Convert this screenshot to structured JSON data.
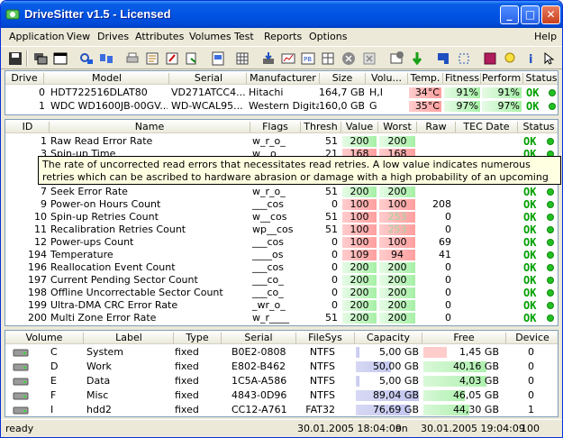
{
  "window": {
    "title": "DriveSitter v1.5 - Licensed"
  },
  "menu": [
    "Application",
    "View",
    "Drives",
    "Attributes",
    "Volumes",
    "Test",
    "Reports",
    "Options"
  ],
  "help": "Help",
  "drives": {
    "headers": [
      "Drive",
      "Model",
      "Serial",
      "Manufacturer",
      "Size",
      "Volu...",
      "Temp.",
      "Fitness",
      "Perform.",
      "Status"
    ],
    "rows": [
      {
        "drive": "0",
        "model": "HDT722516DLAT80",
        "serial": "VD271ATCC4...",
        "manufacturer": "Hitachi",
        "size": "164,7 GB",
        "volumes": "H,I",
        "temp": "34°C",
        "fitness": "91%",
        "perform": "91%",
        "status": "OK"
      },
      {
        "drive": "1",
        "model": "WDC WD1600JB-00GV...",
        "serial": "WD-WCAL95...",
        "manufacturer": "Western Digital",
        "size": "160,0 GB",
        "volumes": "G",
        "temp": "35°C",
        "fitness": "97%",
        "perform": "97%",
        "status": "OK"
      }
    ]
  },
  "attributes": {
    "headers": [
      "ID",
      "Name",
      "Flags",
      "Thresh",
      "Value",
      "Worst",
      "Raw",
      "TEC Date",
      "Status"
    ],
    "rows": [
      {
        "id": "1",
        "name": "Raw Read Error Rate",
        "flags": "w_r_o_",
        "thresh": "51",
        "value": "200",
        "worst": "200",
        "raw": "",
        "tec": "",
        "status": "OK",
        "tone": "green"
      },
      {
        "id": "3",
        "name": "Spin-up Time",
        "flags": "w__o_",
        "thresh": "21",
        "value": "168",
        "worst": "168",
        "raw": "",
        "tec": "",
        "status": "OK",
        "tone": "red"
      },
      {
        "id": "7",
        "name": "Seek Error Rate",
        "flags": "w_r_o_",
        "thresh": "51",
        "value": "200",
        "worst": "200",
        "raw": "",
        "tec": "",
        "status": "OK",
        "tone": "green"
      },
      {
        "id": "9",
        "name": "Power-on Hours Count",
        "flags": "___cos",
        "thresh": "0",
        "value": "100",
        "worst": "100",
        "raw": "208",
        "tec": "",
        "status": "OK",
        "tone": "red"
      },
      {
        "id": "10",
        "name": "Spin-up Retries Count",
        "flags": "w__cos",
        "thresh": "51",
        "value": "100",
        "worst": "253",
        "raw": "0",
        "tec": "",
        "status": "OK",
        "tone": "red"
      },
      {
        "id": "11",
        "name": "Recalibration Retries Count",
        "flags": "wp__cos",
        "thresh": "51",
        "value": "100",
        "worst": "253",
        "raw": "0",
        "tec": "",
        "status": "OK",
        "tone": "red"
      },
      {
        "id": "12",
        "name": "Power-ups Count",
        "flags": "___cos",
        "thresh": "0",
        "value": "100",
        "worst": "100",
        "raw": "69",
        "tec": "",
        "status": "OK",
        "tone": "red"
      },
      {
        "id": "194",
        "name": "Temperature",
        "flags": "____os",
        "thresh": "0",
        "value": "109",
        "worst": "94",
        "raw": "41",
        "tec": "",
        "status": "OK",
        "tone": "red"
      },
      {
        "id": "196",
        "name": "Reallocation Event Count",
        "flags": "___cos",
        "thresh": "0",
        "value": "200",
        "worst": "200",
        "raw": "0",
        "tec": "",
        "status": "OK",
        "tone": "green"
      },
      {
        "id": "197",
        "name": "Current Pending Sector Count",
        "flags": "___co_",
        "thresh": "0",
        "value": "200",
        "worst": "200",
        "raw": "0",
        "tec": "",
        "status": "OK",
        "tone": "green"
      },
      {
        "id": "198",
        "name": "Offline Uncorrectable Sector Count",
        "flags": "___co_",
        "thresh": "0",
        "value": "200",
        "worst": "200",
        "raw": "0",
        "tec": "",
        "status": "OK",
        "tone": "green"
      },
      {
        "id": "199",
        "name": "Ultra-DMA CRC Error Rate",
        "flags": "_wr_o_",
        "thresh": "0",
        "value": "200",
        "worst": "200",
        "raw": "0",
        "tec": "",
        "status": "OK",
        "tone": "green"
      },
      {
        "id": "200",
        "name": "Multi Zone Error Rate",
        "flags": "w_r____",
        "thresh": "51",
        "value": "200",
        "worst": "200",
        "raw": "0",
        "tec": "",
        "status": "OK",
        "tone": "green"
      }
    ]
  },
  "tooltip": "The rate of uncorrected read errors that necessitates read retries. A low value indicates numerous retries which can be ascribed to hardware abrasion or damage with a high probability of an upcoming drive failure. Data integrity is at risk.",
  "volumes": {
    "headers": [
      "Volume",
      "Label",
      "Type",
      "Serial",
      "FileSys",
      "Capacity",
      "Free",
      "Device"
    ],
    "rows": [
      {
        "letter": "C",
        "label": "System",
        "type": "fixed",
        "serial": "B0E2-0808",
        "fs": "NTFS",
        "capacity": "5,00 GB",
        "cap_frac": 0.056,
        "free": "1,45 GB",
        "free_frac": 0.29,
        "free_tone": "red",
        "device": "0"
      },
      {
        "letter": "D",
        "label": "Work",
        "type": "fixed",
        "serial": "E802-B462",
        "fs": "NTFS",
        "capacity": "50,00 GB",
        "cap_frac": 0.56,
        "free": "40,16 GB",
        "free_frac": 0.8,
        "free_tone": "green",
        "device": "0"
      },
      {
        "letter": "E",
        "label": "Data",
        "type": "fixed",
        "serial": "1C5A-A586",
        "fs": "NTFS",
        "capacity": "5,00 GB",
        "cap_frac": 0.056,
        "free": "4,03 GB",
        "free_frac": 0.8,
        "free_tone": "green",
        "device": "0"
      },
      {
        "letter": "F",
        "label": "Misc",
        "type": "fixed",
        "serial": "4843-0D96",
        "fs": "NTFS",
        "capacity": "89,04 GB",
        "cap_frac": 1.0,
        "free": "46,05 GB",
        "free_frac": 0.52,
        "free_tone": "green",
        "device": "0"
      },
      {
        "letter": "I",
        "label": "hdd2",
        "type": "fixed",
        "serial": "CC12-A761",
        "fs": "FAT32",
        "capacity": "76,69 GB",
        "cap_frac": 0.86,
        "free": "44,30 GB",
        "free_frac": 0.58,
        "free_tone": "green",
        "device": "1"
      }
    ]
  },
  "status": {
    "state": "ready",
    "time1": "30.01.2005 18:04:09",
    "on": "on",
    "time2": "30.01.2005 19:04:09",
    "count": "100"
  }
}
